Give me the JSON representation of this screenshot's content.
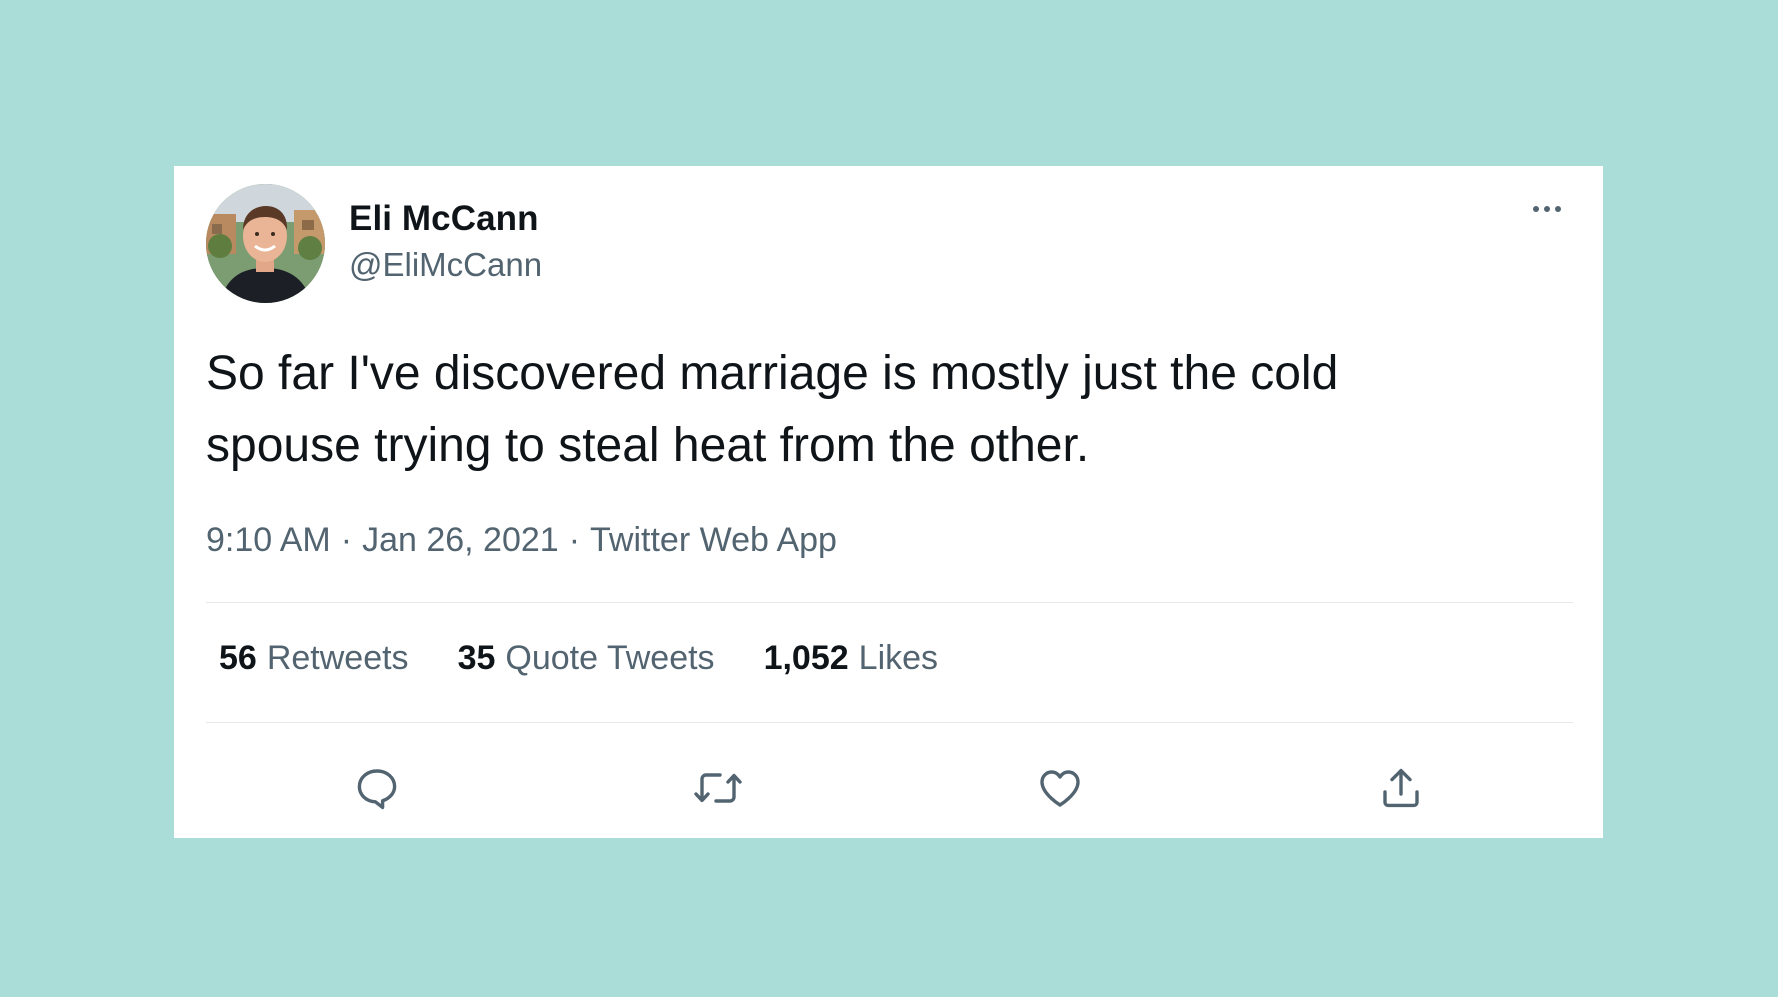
{
  "tweet": {
    "author_name": "Eli McCann",
    "author_handle": "@EliMcCann",
    "text_line1": "So far I've discovered marriage is mostly just the cold",
    "text_line2": "spouse trying to steal heat from the other.",
    "time": "9:10 AM",
    "date": "Jan 26, 2021",
    "source": "Twitter Web App",
    "separator": "·"
  },
  "stats": [
    {
      "count": "56",
      "label": "Retweets"
    },
    {
      "count": "35",
      "label": "Quote Tweets"
    },
    {
      "count": "1,052",
      "label": "Likes"
    }
  ],
  "actions": [
    {
      "icon": "reply-icon"
    },
    {
      "icon": "retweet-icon"
    },
    {
      "icon": "heart-icon"
    },
    {
      "icon": "share-icon"
    }
  ],
  "colors": {
    "background": "#aaddd8",
    "card": "#ffffff",
    "primary_text": "#0f1419",
    "secondary_text": "#536471"
  }
}
